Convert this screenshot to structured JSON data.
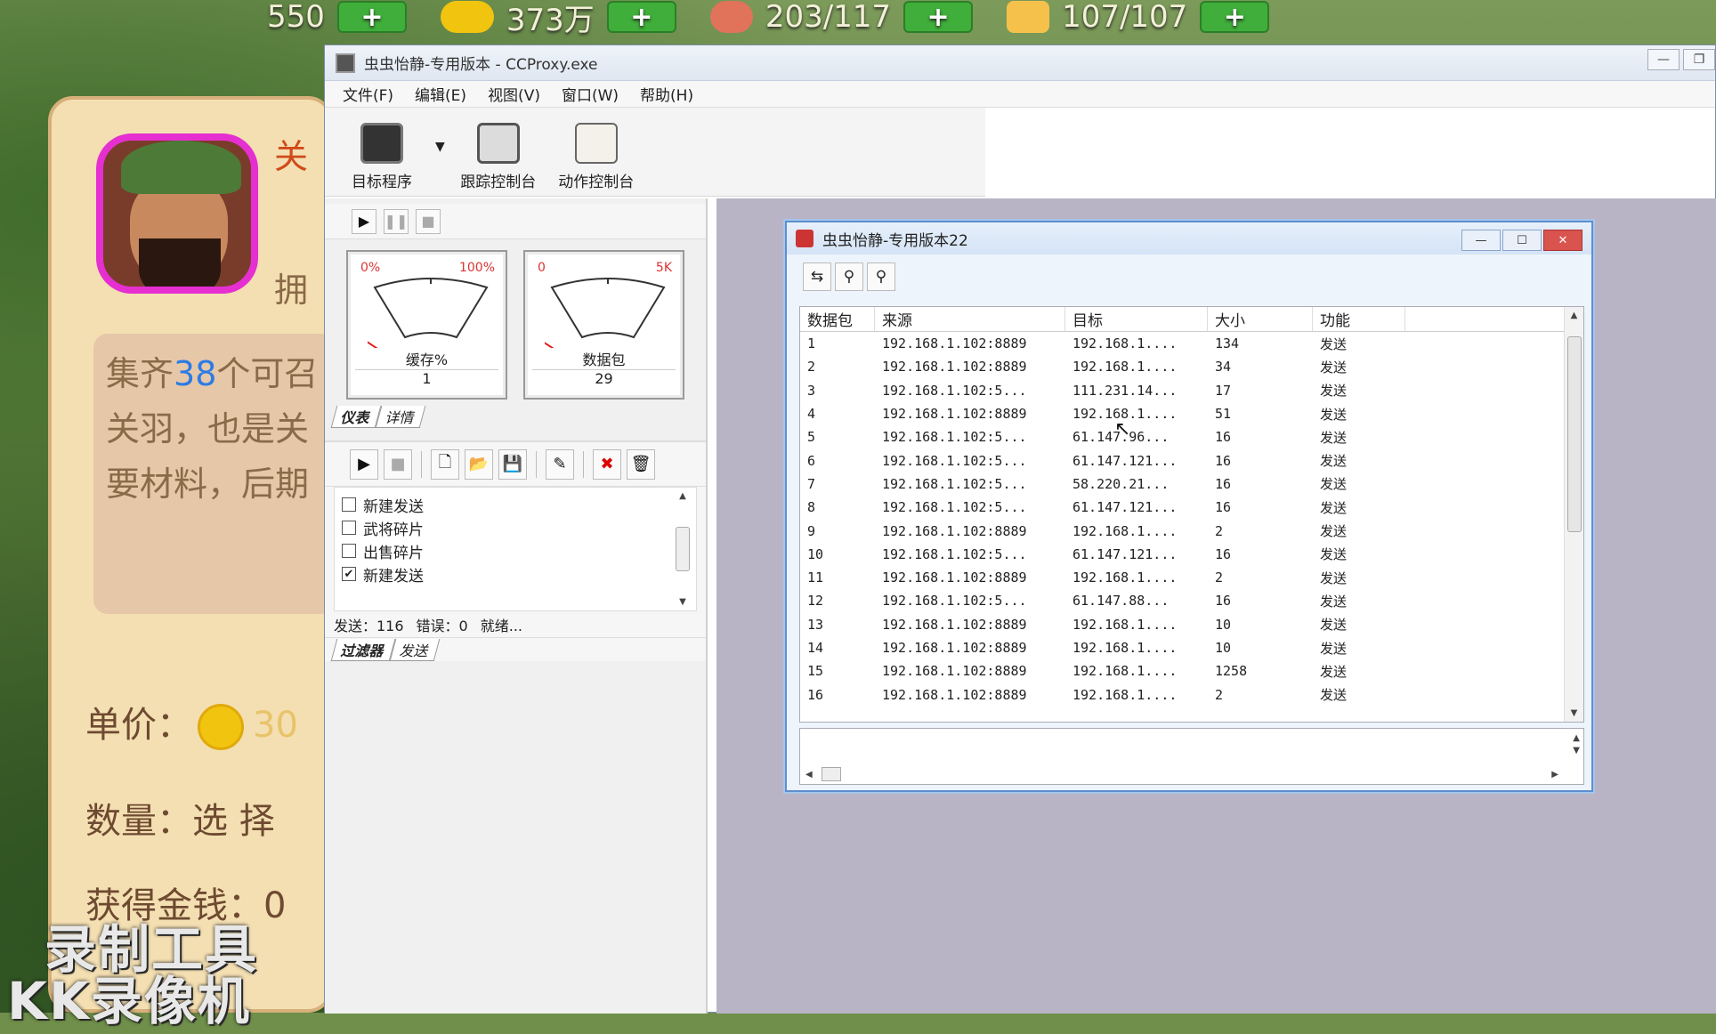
{
  "game": {
    "stats": [
      {
        "value": "550",
        "icon": "gem-icon"
      },
      {
        "value": "373万",
        "icon": "coin-icon"
      },
      {
        "value": "203/117",
        "icon": "meat-icon"
      },
      {
        "value": "107/107",
        "icon": "stamina-icon"
      }
    ],
    "plus_label": "+",
    "hero_name": "关",
    "hold_text": "拥",
    "desc_lines": [
      "集齐",
      "38",
      "个可召",
      "关羽，也是关",
      "要材料，后期"
    ],
    "price_label": "单价：",
    "price_value": "30",
    "qty_label": "数量：选 择",
    "gold_label": "获得金钱：0",
    "watermark1": "录制工具",
    "watermark2": "KK录像机"
  },
  "main_window": {
    "title": "虫虫怡静-专用版本 - CCProxy.exe",
    "controls": [
      "—",
      "❐"
    ],
    "menu": [
      "文件(F)",
      "编辑(E)",
      "视图(V)",
      "窗口(W)",
      "帮助(H)"
    ],
    "toolbar": [
      {
        "label": "目标程序",
        "icon": "chip-icon"
      },
      {
        "label": "跟踪控制台",
        "icon": "magnifier-icon"
      },
      {
        "label": "动作控制台",
        "icon": "edit-note-icon"
      }
    ],
    "gauges": [
      {
        "min": "0%",
        "max": "100%",
        "label": "缓存%",
        "value": "1",
        "level": 0.01
      },
      {
        "min": "0",
        "max": "5K",
        "label": "数据包",
        "value": "29",
        "level": 0.006
      }
    ],
    "gauge_tabs": [
      "仪表",
      "详情"
    ],
    "checklist": [
      {
        "label": "新建发送",
        "checked": false
      },
      {
        "label": "武将碎片",
        "checked": false
      },
      {
        "label": "出售碎片",
        "checked": false
      },
      {
        "label": "新建发送",
        "checked": true
      }
    ],
    "status": {
      "send": "发送：116",
      "error": "错误：0",
      "ready": "就绪..."
    },
    "bottom_tabs": [
      "过滤器",
      "发送"
    ]
  },
  "child_window": {
    "title": "虫虫怡静-专用版本22",
    "columns": [
      "数据包",
      "来源",
      "目标",
      "大小",
      "功能"
    ],
    "rows": [
      [
        "1",
        "192.168.1.102:8889",
        "192.168.1....",
        "134",
        "发送"
      ],
      [
        "2",
        "192.168.1.102:8889",
        "192.168.1....",
        "34",
        "发送"
      ],
      [
        "3",
        "192.168.1.102:5...",
        "111.231.14...",
        "17",
        "发送"
      ],
      [
        "4",
        "192.168.1.102:8889",
        "192.168.1....",
        "51",
        "发送"
      ],
      [
        "5",
        "192.168.1.102:5...",
        "61.147.96...",
        "16",
        "发送"
      ],
      [
        "6",
        "192.168.1.102:5...",
        "61.147.121...",
        "16",
        "发送"
      ],
      [
        "7",
        "192.168.1.102:5...",
        "58.220.21...",
        "16",
        "发送"
      ],
      [
        "8",
        "192.168.1.102:5...",
        "61.147.121...",
        "16",
        "发送"
      ],
      [
        "9",
        "192.168.1.102:8889",
        "192.168.1....",
        "2",
        "发送"
      ],
      [
        "10",
        "192.168.1.102:5...",
        "61.147.121...",
        "16",
        "发送"
      ],
      [
        "11",
        "192.168.1.102:8889",
        "192.168.1....",
        "2",
        "发送"
      ],
      [
        "12",
        "192.168.1.102:5...",
        "61.147.88...",
        "16",
        "发送"
      ],
      [
        "13",
        "192.168.1.102:8889",
        "192.168.1....",
        "10",
        "发送"
      ],
      [
        "14",
        "192.168.1.102:8889",
        "192.168.1....",
        "10",
        "发送"
      ],
      [
        "15",
        "192.168.1.102:8889",
        "192.168.1....",
        "1258",
        "发送"
      ],
      [
        "16",
        "192.168.1.102:8889",
        "192.168.1....",
        "2",
        "发送"
      ]
    ]
  }
}
